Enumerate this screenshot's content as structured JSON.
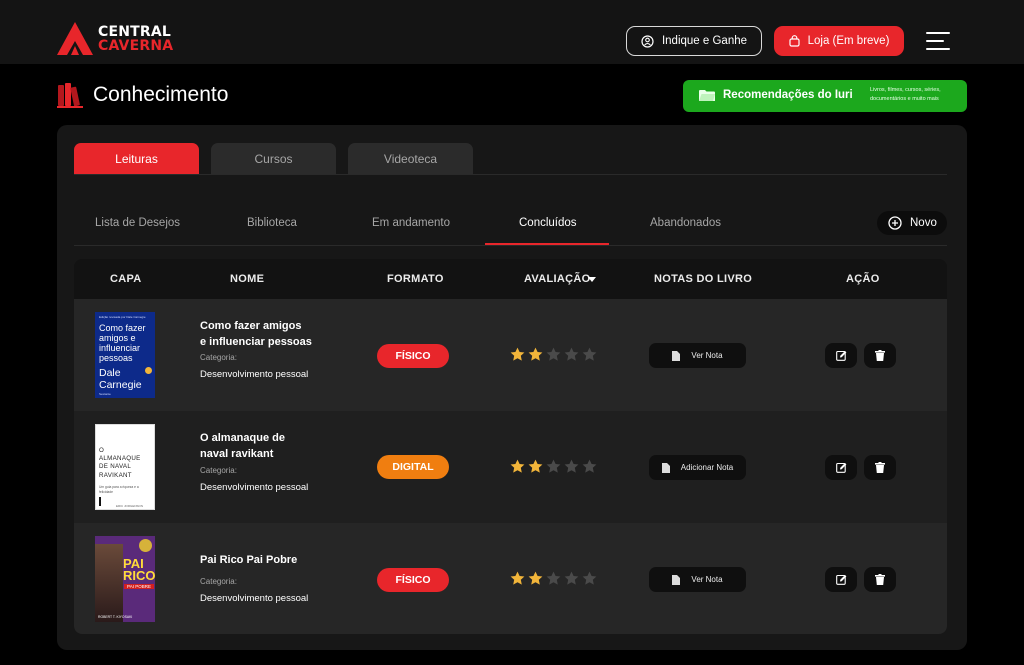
{
  "brand": {
    "line1": "CENTRAL",
    "line2": "CAVERNA",
    "color": "#e8262b"
  },
  "header": {
    "indique_label": "Indique e Ganhe",
    "loja_label": "Loja (Em breve)"
  },
  "page": {
    "title": "Conhecimento",
    "recs_label": "Recomendações do Iuri",
    "recs_sub": "Livros, filmes, cursos, séries, documentários e muito mais"
  },
  "tabs": [
    {
      "label": "Leituras",
      "active": true
    },
    {
      "label": "Cursos",
      "active": false
    },
    {
      "label": "Videoteca",
      "active": false
    }
  ],
  "subtabs": [
    {
      "label": "Lista de Desejos"
    },
    {
      "label": "Biblioteca"
    },
    {
      "label": "Em andamento"
    },
    {
      "label": "Concluídos",
      "active": true
    },
    {
      "label": "Abandonados"
    }
  ],
  "novo_label": "Novo",
  "table": {
    "headers": {
      "capa": "CAPA",
      "nome": "NOME",
      "formato": "FORMATO",
      "avaliacao": "AVALIAÇÃO",
      "notas": "NOTAS DO LIVRO",
      "acao": "AÇÃO"
    },
    "rows": [
      {
        "title_line1": "Como fazer amigos",
        "title_line2": "e influenciar pessoas",
        "category_label": "Categoria:",
        "category": "Desenvolvimento pessoal",
        "format": "FÍSICO",
        "format_color": "#e8262b",
        "rating": 2,
        "rating_max": 5,
        "note_label": "Ver Nota",
        "cover": {
          "top": "Edição revisada por Dale Carnegie",
          "title": "Como fazer amigos e influenciar pessoas",
          "author_line1": "Dale",
          "author_line2": "Carnegie",
          "publisher": "Sextante"
        }
      },
      {
        "title_line1": "O almanaque de",
        "title_line2": "naval ravikant",
        "category_label": "Categoria:",
        "category": "Desenvolvimento pessoal",
        "format": "DIGITAL",
        "format_color": "#f07e10",
        "rating": 2,
        "rating_max": 5,
        "note_label": "Adicionar Nota",
        "cover": {
          "title": "O ALMANAQUE DE NAVAL RAVIKANT",
          "subtitle": "Um guia para a riqueza e a felicidade",
          "author": "ERIC JORGENSON"
        }
      },
      {
        "title_line1": "Pai Rico Pai Pobre",
        "title_line2": "",
        "category_label": "Categoria:",
        "category": "Desenvolvimento pessoal",
        "format": "FÍSICO",
        "format_color": "#e8262b",
        "rating": 2,
        "rating_max": 5,
        "note_label": "Ver Nota",
        "cover": {
          "title_line1": "PAI",
          "title_line2": "RICO",
          "title_line3": "PAI POBRE",
          "author": "ROBERT T. KIYOSAKI"
        }
      }
    ]
  },
  "colors": {
    "accent": "#e8262b",
    "green": "#1ca81d",
    "star_on": "#f2b53a",
    "star_off": "#4a4a4a"
  }
}
